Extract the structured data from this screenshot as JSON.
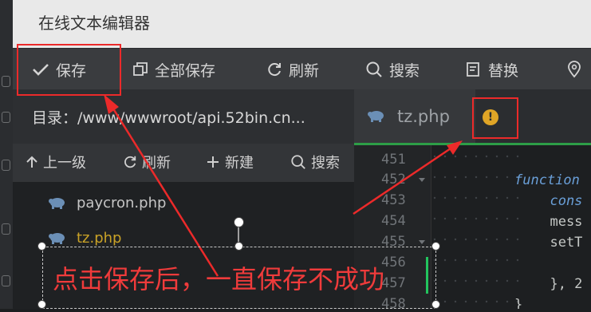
{
  "window": {
    "title": "在线文本编辑器"
  },
  "toolbar": {
    "save": "保存",
    "save_all": "全部保存",
    "refresh": "刷新",
    "search": "搜索",
    "replace": "替换"
  },
  "directory": {
    "label": "目录：/www/wwwroot/api.52bin.cn..."
  },
  "filebar": {
    "up": "上一级",
    "refresh": "刷新",
    "new": "新建",
    "search": "搜索"
  },
  "files": [
    {
      "name": "paycron.php",
      "color": "#c5c5c5"
    },
    {
      "name": "tz.php",
      "color": "#c9a227"
    }
  ],
  "editor": {
    "tab_name": "tz.php",
    "status_badge": "!",
    "line_numbers": [
      "451",
      "452",
      "453",
      "454",
      "455",
      "456",
      "457",
      "458"
    ],
    "code_lines": [
      {
        "text": "",
        "color": "#c5c8c6"
      },
      {
        "text": "function",
        "color": "#6a9fd8"
      },
      {
        "text": "  cons",
        "color": "#6a9fd8"
      },
      {
        "text": "  mess",
        "color": "#c5c8c6"
      },
      {
        "text": "  setT",
        "color": "#c5c8c6"
      },
      {
        "text": "",
        "color": "#c5c8c6"
      },
      {
        "text": "  }, 2",
        "color": "#c5c8c6"
      },
      {
        "text": "}",
        "color": "#c5c8c6"
      }
    ]
  },
  "annotation": {
    "text": "点击保存后，一直保存不成功",
    "color": "#ec2a2a"
  },
  "colors": {
    "accent_green": "#2d9e47",
    "annotation_red": "#ec2a2a",
    "badge_orange": "#e0a526"
  }
}
